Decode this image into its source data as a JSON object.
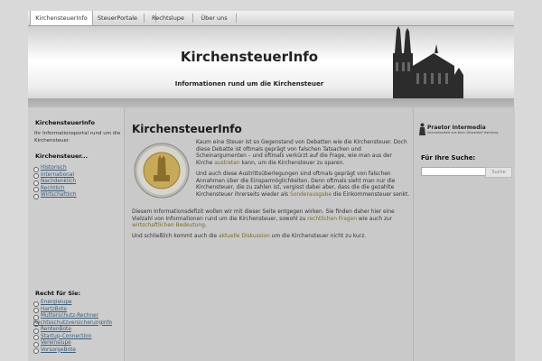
{
  "nav": {
    "tabs": [
      {
        "label": "KirchensteuerInfo",
        "active": true
      },
      {
        "label": "SteuerPortale",
        "active": false
      },
      {
        "label": "Rechtslupe",
        "active": false
      },
      {
        "label": "Über uns",
        "active": false
      }
    ]
  },
  "header": {
    "title": "KirchensteuerInfo",
    "subtitle": "Informationen rund um die Kirchensteuer"
  },
  "left_sidebar": {
    "about_heading": "KirchensteuerInfo",
    "about_text": "Ihr Informationsportal rund um die Kirchensteuer.",
    "topics_heading": "Kirchensteuer...",
    "topics": [
      "Historisch",
      "International",
      "Nachdenklich",
      "Rechtlich",
      "Wirtschaftlich"
    ],
    "law_heading": "Recht für Sie:",
    "law_links": [
      "Energielupe",
      "HartzBote",
      "Mutterschutz-Rechner",
      "",
      "Rechtsschutzversicherunginfo",
      "RentenBote",
      "Startup-Connection",
      "Vereinslupe",
      "VorsorgeBote"
    ]
  },
  "main": {
    "title": "KirchensteuerInfo",
    "p1_a": "Kaum eine Steuer ist so Gegenstand von Debatten wie die Kirchensteuer. Doch diese Debatte ist oftmals geprägt von falschen Tatsachen und Scheinargumenten – und oftmals verkürzt auf die Frage, wie man aus der Kirche",
    "p1_link": "austreten",
    "p1_b": "kann, um die Kirchensteuer zu sparen.",
    "p2_a": "Und auch diese Austrittsüberlegungen sind oftmals geprägt von falschen Annahmen über die Einsparmöglichkeiten. Denn oftmals sieht man nur die Kirchensteuer, die zu zahlen ist, vergisst dabei aber, dass die die gezahlte Kirchensteuer ihrerseits wieder als",
    "p2_link": "Sonderausgabe",
    "p2_b": "die Einkommensteuer senkt.",
    "p3_a": "Diesem Informationsdefizit wollen wir mit dieser Seite entgegen wirken. Sie finden daher hier eine Vielzahl von Informationen rund um die Kirchensteuer, sowohl zu",
    "p3_link1": "rechtlichen Fragen",
    "p3_mid": "wie auch zur",
    "p3_link2": "wirtschaftlichen Bedeutung",
    "p3_end": ".",
    "p4_a": "Und schließlich kommt auch die",
    "p4_link": "aktuelle Diskussion",
    "p4_b": "um die Kirchensteuer nicht zu kurz."
  },
  "right_sidebar": {
    "sponsor_name": "Praetor Intermedia",
    "sponsor_sub": "Internetportale aus Bonn Düsseldorf Hamburg",
    "search_heading": "Für Ihre Suche:",
    "search_value": "",
    "search_button": "Suche"
  }
}
